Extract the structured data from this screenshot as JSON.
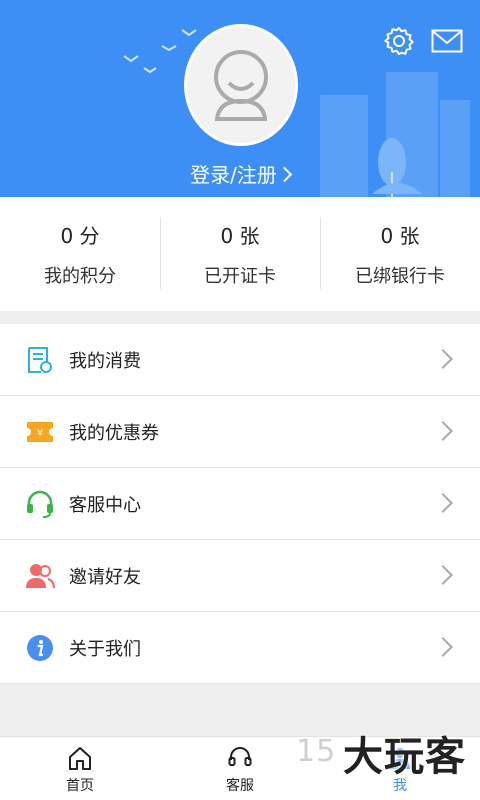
{
  "header": {
    "login_label": "登录/注册",
    "color": "#3d8ef5"
  },
  "stats": [
    {
      "value": "0 分",
      "label": "我的积分"
    },
    {
      "value": "0 张",
      "label": "已开证卡"
    },
    {
      "value": "0 张",
      "label": "已绑银行卡"
    }
  ],
  "menu": [
    {
      "label": "我的消费",
      "icon": "receipt-icon"
    },
    {
      "label": "我的优惠券",
      "icon": "coupon-icon"
    },
    {
      "label": "客服中心",
      "icon": "headset-icon"
    },
    {
      "label": "邀请好友",
      "icon": "invite-friends-icon"
    },
    {
      "label": "关于我们",
      "icon": "info-icon"
    }
  ],
  "tabs": [
    {
      "label": "首页",
      "icon": "home-icon"
    },
    {
      "label": "客服",
      "icon": "headset-icon"
    },
    {
      "label": "我",
      "icon": "person-icon",
      "active": true
    }
  ],
  "watermark": {
    "text": "大玩客",
    "digits": "15"
  }
}
